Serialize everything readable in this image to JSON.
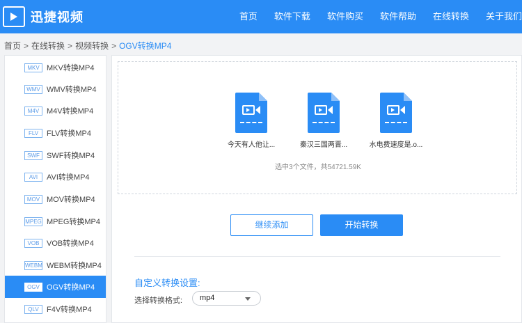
{
  "header": {
    "logo_text": "迅捷视频",
    "nav": [
      "首页",
      "软件下载",
      "软件购买",
      "软件帮助",
      "在线转换",
      "关于我们"
    ]
  },
  "breadcrumb": [
    "首页",
    "在线转换",
    "视频转换",
    "OGV转换MP4"
  ],
  "sidebar": {
    "items": [
      {
        "fmt": "MKV",
        "label": "MKV转换MP4"
      },
      {
        "fmt": "WMV",
        "label": "WMV转换MP4"
      },
      {
        "fmt": "M4V",
        "label": "M4V转换MP4"
      },
      {
        "fmt": "FLV",
        "label": "FLV转换MP4"
      },
      {
        "fmt": "SWF",
        "label": "SWF转换MP4"
      },
      {
        "fmt": "AVI",
        "label": "AVI转换MP4"
      },
      {
        "fmt": "MOV",
        "label": "MOV转换MP4"
      },
      {
        "fmt": "MPEG",
        "label": "MPEG转换MP4"
      },
      {
        "fmt": "VOB",
        "label": "VOB转换MP4"
      },
      {
        "fmt": "WEBM",
        "label": "WEBM转换MP4"
      },
      {
        "fmt": "OGV",
        "label": "OGV转换MP4"
      },
      {
        "fmt": "QLV",
        "label": "F4V转换MP4"
      }
    ],
    "active_index": 10
  },
  "files": [
    {
      "name": "今天有人他让..."
    },
    {
      "name": "秦汉三国两晋..."
    },
    {
      "name": "水电费速度是.o..."
    }
  ],
  "summary": "选中3个文件，共54721.59K",
  "buttons": {
    "add": "继续添加",
    "start": "开始转换"
  },
  "settings": {
    "title": "自定义转换设置:",
    "format_label": "选择转换格式:",
    "format_value": "mp4"
  },
  "colors": {
    "accent": "#2a8cf5"
  }
}
